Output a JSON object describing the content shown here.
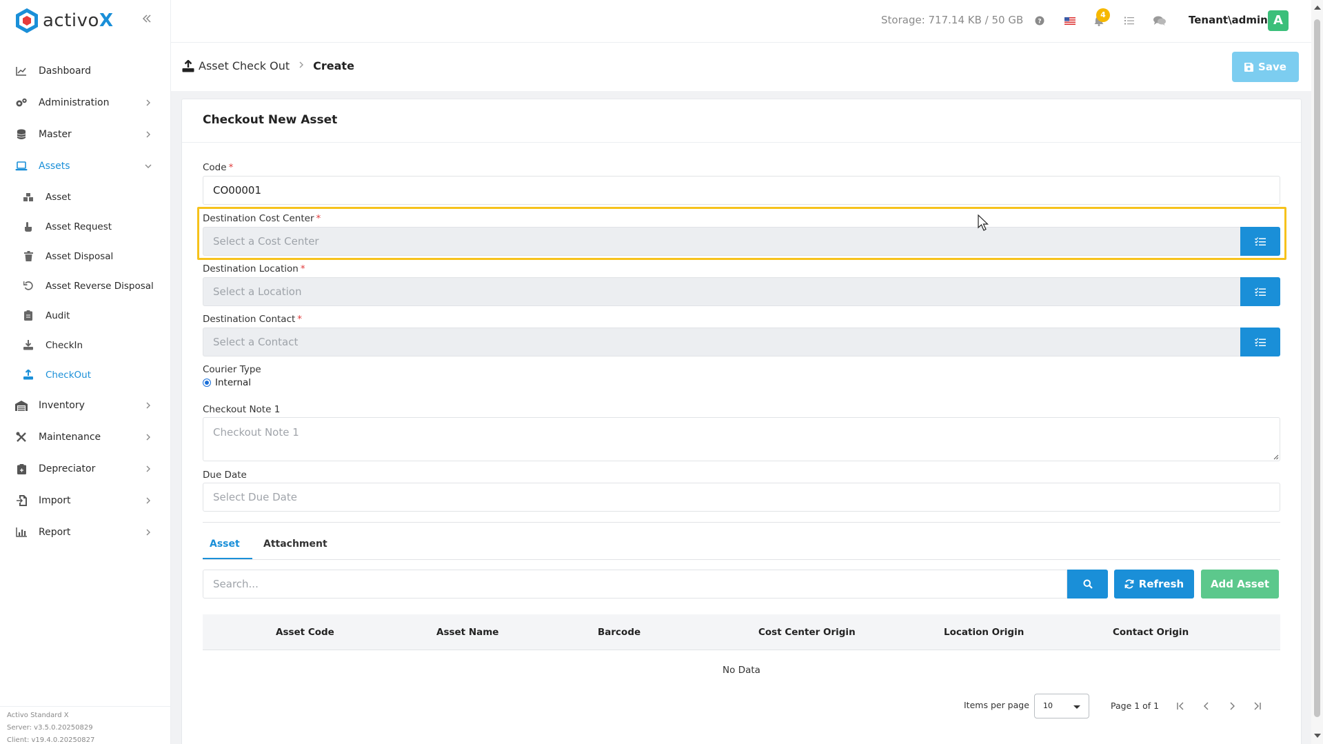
{
  "app": {
    "logo_text": "activo",
    "logo_x": "X"
  },
  "sidebar": {
    "items": [
      {
        "label": "Dashboard"
      },
      {
        "label": "Administration"
      },
      {
        "label": "Master"
      },
      {
        "label": "Assets"
      },
      {
        "label": "Asset"
      },
      {
        "label": "Asset Request"
      },
      {
        "label": "Asset Disposal"
      },
      {
        "label": "Asset Reverse Disposal"
      },
      {
        "label": "Audit"
      },
      {
        "label": "CheckIn"
      },
      {
        "label": "CheckOut"
      },
      {
        "label": "Inventory"
      },
      {
        "label": "Maintenance"
      },
      {
        "label": "Depreciator"
      },
      {
        "label": "Import"
      },
      {
        "label": "Report"
      }
    ],
    "footer": {
      "product": "Activo Standard X",
      "server": "Server: v3.5.0.20250829",
      "client": "Client: v19.4.0.20250827"
    }
  },
  "topbar": {
    "storage": "Storage: 717.14 KB / 50 GB",
    "notification_count": "4",
    "user": "Tenant\\admin",
    "avatar_initial": "A"
  },
  "breadcrumb": {
    "parent": "Asset Check Out",
    "current": "Create"
  },
  "toolbar": {
    "save_label": "Save"
  },
  "form": {
    "title": "Checkout New Asset",
    "code_label": "Code",
    "code_value": "CO00001",
    "cost_center_label": "Destination Cost Center",
    "cost_center_placeholder": "Select a Cost Center",
    "location_label": "Destination Location",
    "location_placeholder": "Select a Location",
    "contact_label": "Destination Contact",
    "contact_placeholder": "Select a Contact",
    "courier_label": "Courier Type",
    "courier_option": "Internal",
    "note_label": "Checkout Note 1",
    "note_placeholder": "Checkout Note 1",
    "due_label": "Due Date",
    "due_placeholder": "Select Due Date",
    "required_mark": "*"
  },
  "tabs": {
    "asset": "Asset",
    "attachment": "Attachment"
  },
  "asset_table": {
    "search_placeholder": "Search...",
    "refresh_label": "Refresh",
    "add_label": "Add Asset",
    "columns": [
      "Asset Code",
      "Asset Name",
      "Barcode",
      "Cost Center Origin",
      "Location Origin",
      "Contact Origin"
    ],
    "empty": "No Data",
    "items_per_page_label": "Items per page",
    "items_per_page": "10",
    "page_info": "Page 1 of 1"
  },
  "colors": {
    "accent": "#1a8fd8",
    "success": "#5cc88c",
    "highlight": "#f6c21c",
    "save_disabled": "#7ccdf0"
  }
}
